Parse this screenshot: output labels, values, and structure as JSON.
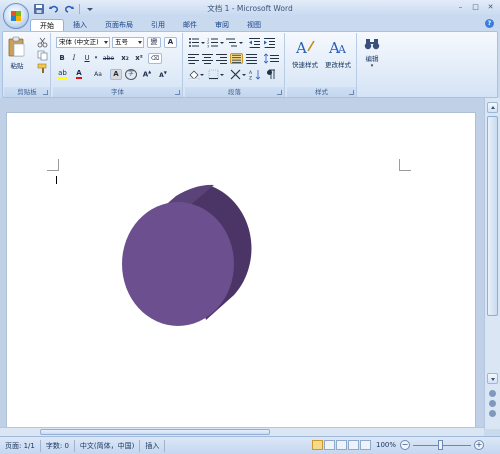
{
  "window": {
    "title": "文档 1 - Microsoft Word",
    "controls": [
      "minimize-icon",
      "maximize-icon",
      "close-icon"
    ]
  },
  "quick_access": [
    "save-icon",
    "undo-icon",
    "redo-icon",
    "customize-dropdown-icon"
  ],
  "tabs": [
    {
      "label": "开始",
      "active": true
    },
    {
      "label": "插入"
    },
    {
      "label": "页面布局"
    },
    {
      "label": "引用"
    },
    {
      "label": "邮件"
    },
    {
      "label": "审阅"
    },
    {
      "label": "视图"
    }
  ],
  "ribbon": {
    "clipboard": {
      "label": "剪贴板",
      "paste_label": "粘贴"
    },
    "font": {
      "label": "字体",
      "font_name": "宋体 (中文正)",
      "font_size": "五号",
      "bold": "B",
      "italic": "I",
      "underline": "U",
      "strike": "abe",
      "subscript": "x₂",
      "superscript": "x²",
      "change_case": "Aa",
      "char_border": "A",
      "font_color": "A",
      "enclose": "字"
    },
    "paragraph": {
      "label": "段落"
    },
    "styles": {
      "label": "样式",
      "quick_styles": "快速样式",
      "change_styles": "更改样式"
    },
    "editing": {
      "label": "编辑"
    }
  },
  "document": {
    "shape": {
      "type": "cylinder",
      "face_color": "#6b4f8f",
      "side_color": "#4a3566",
      "top_color": "#5a4378"
    }
  },
  "status": {
    "page": "页面: 1/1",
    "words": "字数: 0",
    "language": "中文(简体，中国)",
    "mode": "插入",
    "zoom": "100%"
  },
  "colors": {
    "accent": "#c6d8f0",
    "highlight": "#f7d98a",
    "font_color_bar": "#e01010"
  }
}
